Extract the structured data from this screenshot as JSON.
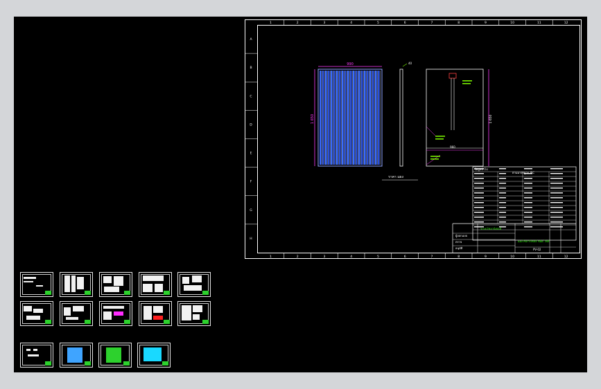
{
  "drawing": {
    "column_numbers": [
      "1",
      "2",
      "3",
      "4",
      "5",
      "6",
      "7",
      "8",
      "9",
      "10",
      "11",
      "12"
    ],
    "row_letters": [
      "A",
      "B",
      "C",
      "D",
      "E",
      "F",
      "G",
      "H"
    ],
    "dimensions": {
      "panel_width": "990",
      "panel_height": "1 650",
      "frame_depth": "40",
      "mount_span": "960",
      "back_height": "1 650"
    },
    "view_caption": "ราคา แผง",
    "title_block": {
      "header_left": "ข้อมูลทั่วไป",
      "header_right": "ตามมาตรฐาน IEC",
      "project_name": "ระบบโซลาร์เซลล์",
      "drawing_title": "แผงโซลาร์เซลล์ ชนิด โพลี",
      "labels": [
        "ผู้ออกแบบ",
        "ตรวจ",
        "อนุมัติ"
      ],
      "sheet_no": "PV-02"
    },
    "colors": {
      "border": "#ffffff",
      "panel_cells": "#3a6cff",
      "dimension": "#ff3cff",
      "notes": "#7fff00",
      "title_text": "#39ff14",
      "frame": "#ff4040"
    }
  },
  "thumbnails": [
    {
      "name": "layout-1"
    },
    {
      "name": "layout-2"
    },
    {
      "name": "layout-3"
    },
    {
      "name": "layout-4"
    },
    {
      "name": "layout-5"
    },
    {
      "name": "layout-6"
    },
    {
      "name": "layout-7"
    },
    {
      "name": "layout-8"
    },
    {
      "name": "layout-9"
    },
    {
      "name": "layout-10"
    },
    {
      "name": "layout-11"
    },
    {
      "name": "layout-12"
    },
    {
      "name": "layout-13"
    },
    {
      "name": "layout-14"
    }
  ]
}
